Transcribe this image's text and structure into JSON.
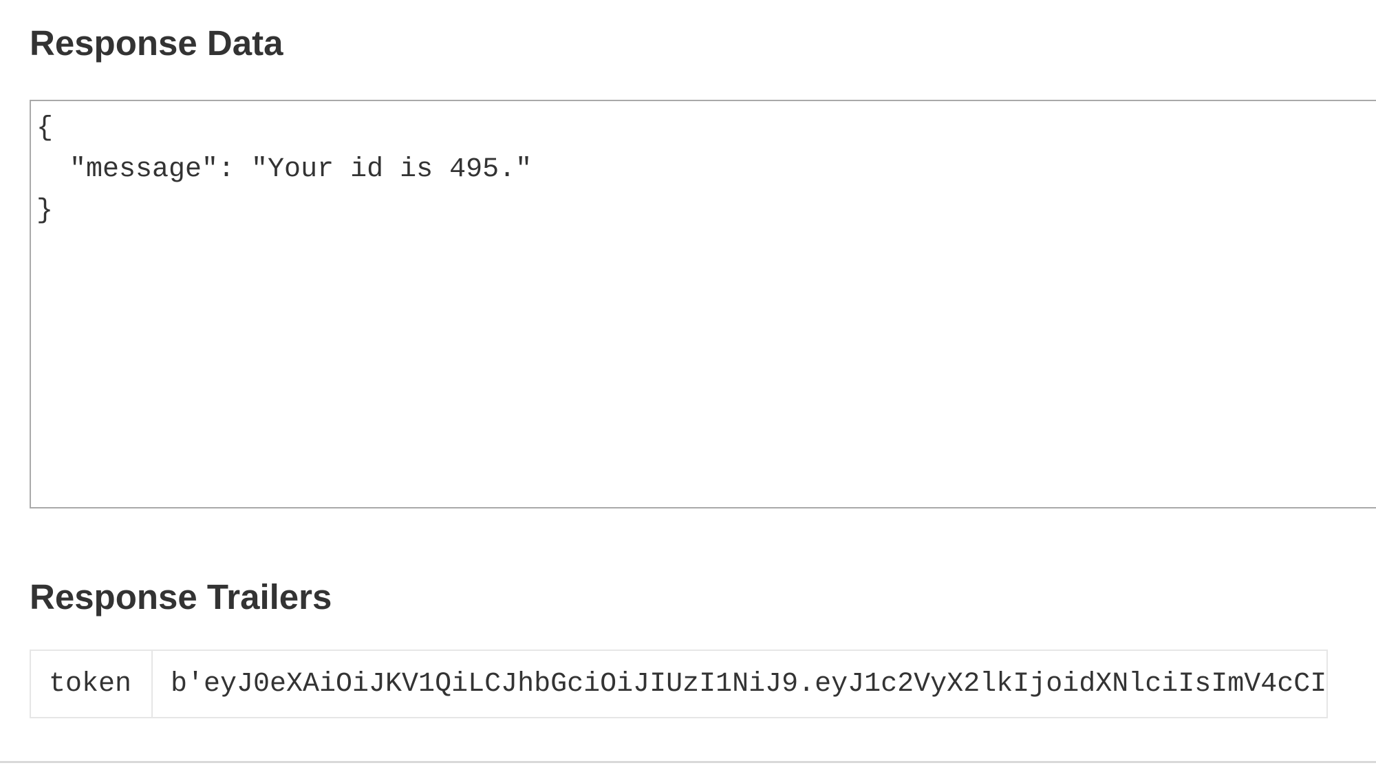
{
  "response_data": {
    "title": "Response Data",
    "body": "{\n  \"message\": \"Your id is 495.\"\n}"
  },
  "response_trailers": {
    "title": "Response Trailers",
    "rows": [
      {
        "key": "token",
        "value": "b'eyJ0eXAiOiJKV1QiLCJhbGciOiJIUzI1NiJ9.eyJ1c2VyX2lkIjoidXNlciIsImV4cCI"
      }
    ]
  }
}
